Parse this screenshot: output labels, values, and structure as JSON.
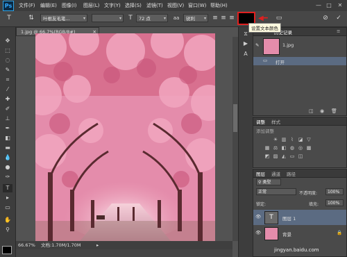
{
  "app": {
    "logo": "Ps"
  },
  "menu": [
    "文件(F)",
    "编辑(E)",
    "图像(I)",
    "图层(L)",
    "文字(Y)",
    "选择(S)",
    "滤镜(T)",
    "视图(V)",
    "窗口(W)",
    "帮助(H)"
  ],
  "window_buttons": {
    "minimize": "—",
    "maximize": "□",
    "close": "✕"
  },
  "options": {
    "font_family": "叶根友毛笔...",
    "font_size": "72 点",
    "antialias": "锐利",
    "text_color": "#000000",
    "tooltip": "设置文本颜色"
  },
  "document": {
    "tab_title": "1.jpg @ 66.7%(RGB/8#)",
    "zoom": "66.67%",
    "doc_info": "文档:1.70M/1.70M"
  },
  "history": {
    "tabs": [
      "历史记录"
    ],
    "snapshot_name": "1.jpg",
    "items": [
      "打开"
    ]
  },
  "adjustments": {
    "tabs": [
      "调整",
      "样式"
    ],
    "add_label": "添加调整"
  },
  "layers": {
    "tabs": [
      "图层",
      "通道",
      "路径"
    ],
    "kind_label": "类型",
    "blend_mode": "正常",
    "opacity_label": "不透明度:",
    "opacity_value": "100%",
    "lock_label": "锁定:",
    "fill_label": "填充:",
    "fill_value": "100%",
    "items": [
      {
        "name": "图层 1",
        "type": "T"
      },
      {
        "name": "背景"
      }
    ]
  },
  "watermark": "jingyan.baidu.com",
  "colors": {
    "blossom": "#e27ea0",
    "trunk": "#5a2a30",
    "path": "#f3b7c6",
    "highlight": "#e02020"
  }
}
